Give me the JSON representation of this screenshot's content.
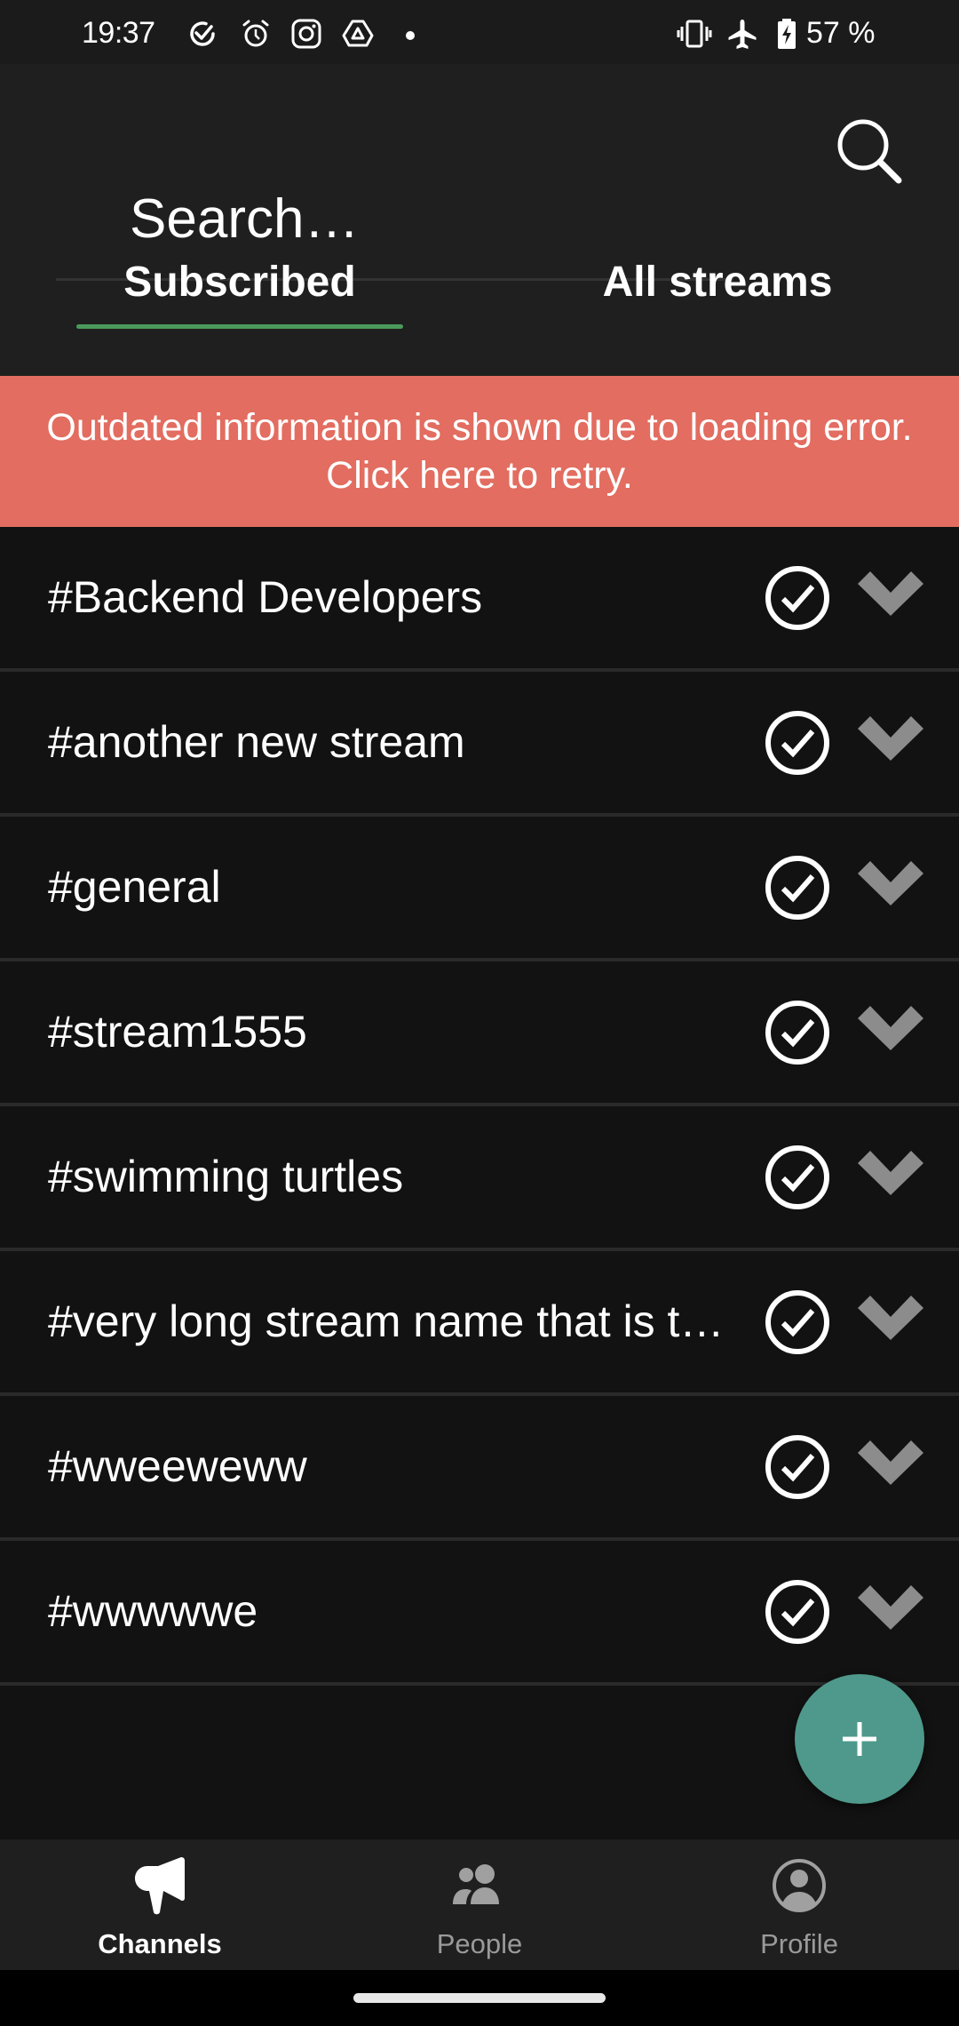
{
  "status_bar": {
    "time": "19:37",
    "left_icons": [
      "task-check-icon",
      "alarm-icon",
      "instagram-icon",
      "drive-icon",
      "notification-dot-icon"
    ],
    "right_icons": [
      "vibrate-icon",
      "airplane-mode-icon",
      "battery-charging-icon"
    ],
    "battery": "57 %"
  },
  "search": {
    "placeholder": "Search…",
    "value": "",
    "icon": "search-icon"
  },
  "tabs": [
    {
      "label": "Subscribed",
      "selected": true
    },
    {
      "label": "All streams",
      "selected": false
    }
  ],
  "colors": {
    "accent_tab_indicator": "#4a9a5c",
    "error_banner": "#e26d60",
    "fab": "#4e998b",
    "header_bg": "#1f1f1f",
    "list_bg": "#121212",
    "divider": "#2a2a2a",
    "chevron": "#8c8c8c",
    "inactive_nav": "#9a9a9a"
  },
  "banner": {
    "text": "Outdated information is shown due to loading error. Click here to retry."
  },
  "streams": [
    {
      "name": "#Backend Developers",
      "subscribed": true
    },
    {
      "name": "#another new stream",
      "subscribed": true
    },
    {
      "name": "#general",
      "subscribed": true
    },
    {
      "name": "#stream1555",
      "subscribed": true
    },
    {
      "name": "#swimming turtles",
      "subscribed": true
    },
    {
      "name": "#very long stream name that is t…",
      "subscribed": true
    },
    {
      "name": "#wweeweww",
      "subscribed": true
    },
    {
      "name": "#wwwwwe",
      "subscribed": true
    }
  ],
  "fab": {
    "icon": "plus-icon",
    "label": "+"
  },
  "bottom_nav": [
    {
      "label": "Channels",
      "icon": "megaphone-icon",
      "active": true
    },
    {
      "label": "People",
      "icon": "people-icon",
      "active": false
    },
    {
      "label": "Profile",
      "icon": "profile-icon",
      "active": false
    }
  ]
}
